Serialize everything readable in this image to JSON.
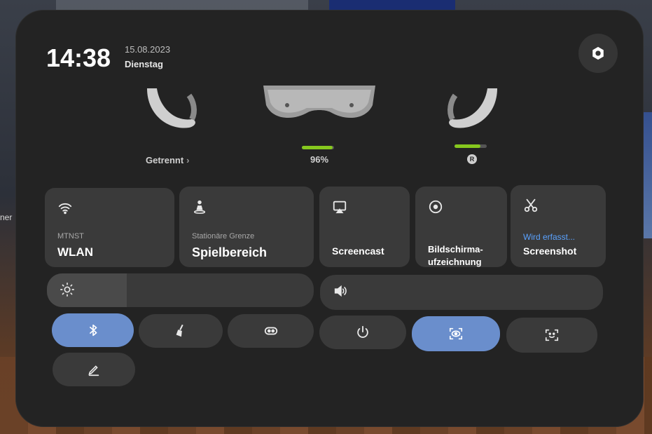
{
  "background": {
    "left_text": "ner"
  },
  "header": {
    "time": "14:38",
    "date": "15.08.2023",
    "day": "Dienstag"
  },
  "devices": {
    "left_controller_status": "Getrennt",
    "headset_battery_percent": 96,
    "headset_battery_label": "96%",
    "right_controller_battery_percent": 80,
    "right_controller_badge": "R"
  },
  "tiles": {
    "wlan": {
      "sub": "MTNST",
      "main": "WLAN",
      "icon": "wifi-icon"
    },
    "spielbereich": {
      "sub": "Stationäre Grenze",
      "main": "Spielbereich",
      "icon": "boundary-person-icon"
    },
    "screencast": {
      "main": "Screencast",
      "icon": "cast-icon"
    },
    "bildschirm": {
      "main1": "Bildschirma-",
      "main2": "ufzeichnung",
      "icon": "record-icon"
    },
    "screenshot": {
      "sub": "Wird erfasst...",
      "main": "Screenshot",
      "icon": "scissors-icon"
    }
  },
  "sliders": {
    "brightness": {
      "icon": "brightness-icon",
      "level_percent": 30
    },
    "volume": {
      "icon": "volume-icon",
      "level_percent": 0
    }
  },
  "toggles": [
    {
      "name": "bluetooth",
      "icon": "bluetooth-icon",
      "on": true
    },
    {
      "name": "cleanup",
      "icon": "broom-icon",
      "on": false
    },
    {
      "name": "vr-mode",
      "icon": "vr-goggles-icon",
      "on": false
    },
    {
      "name": "power",
      "icon": "power-icon",
      "on": false
    },
    {
      "name": "eye-tracking",
      "icon": "eye-tracking-icon",
      "on": true
    },
    {
      "name": "face-tracking",
      "icon": "face-tracking-icon",
      "on": false
    },
    {
      "name": "edit",
      "icon": "pencil-icon",
      "on": false
    }
  ],
  "colors": {
    "panel": "#232323",
    "tile": "#3a3a3a",
    "toggle_on": "#6a8ecc",
    "battery": "#86c81e",
    "capturing": "#5aa2ff"
  }
}
